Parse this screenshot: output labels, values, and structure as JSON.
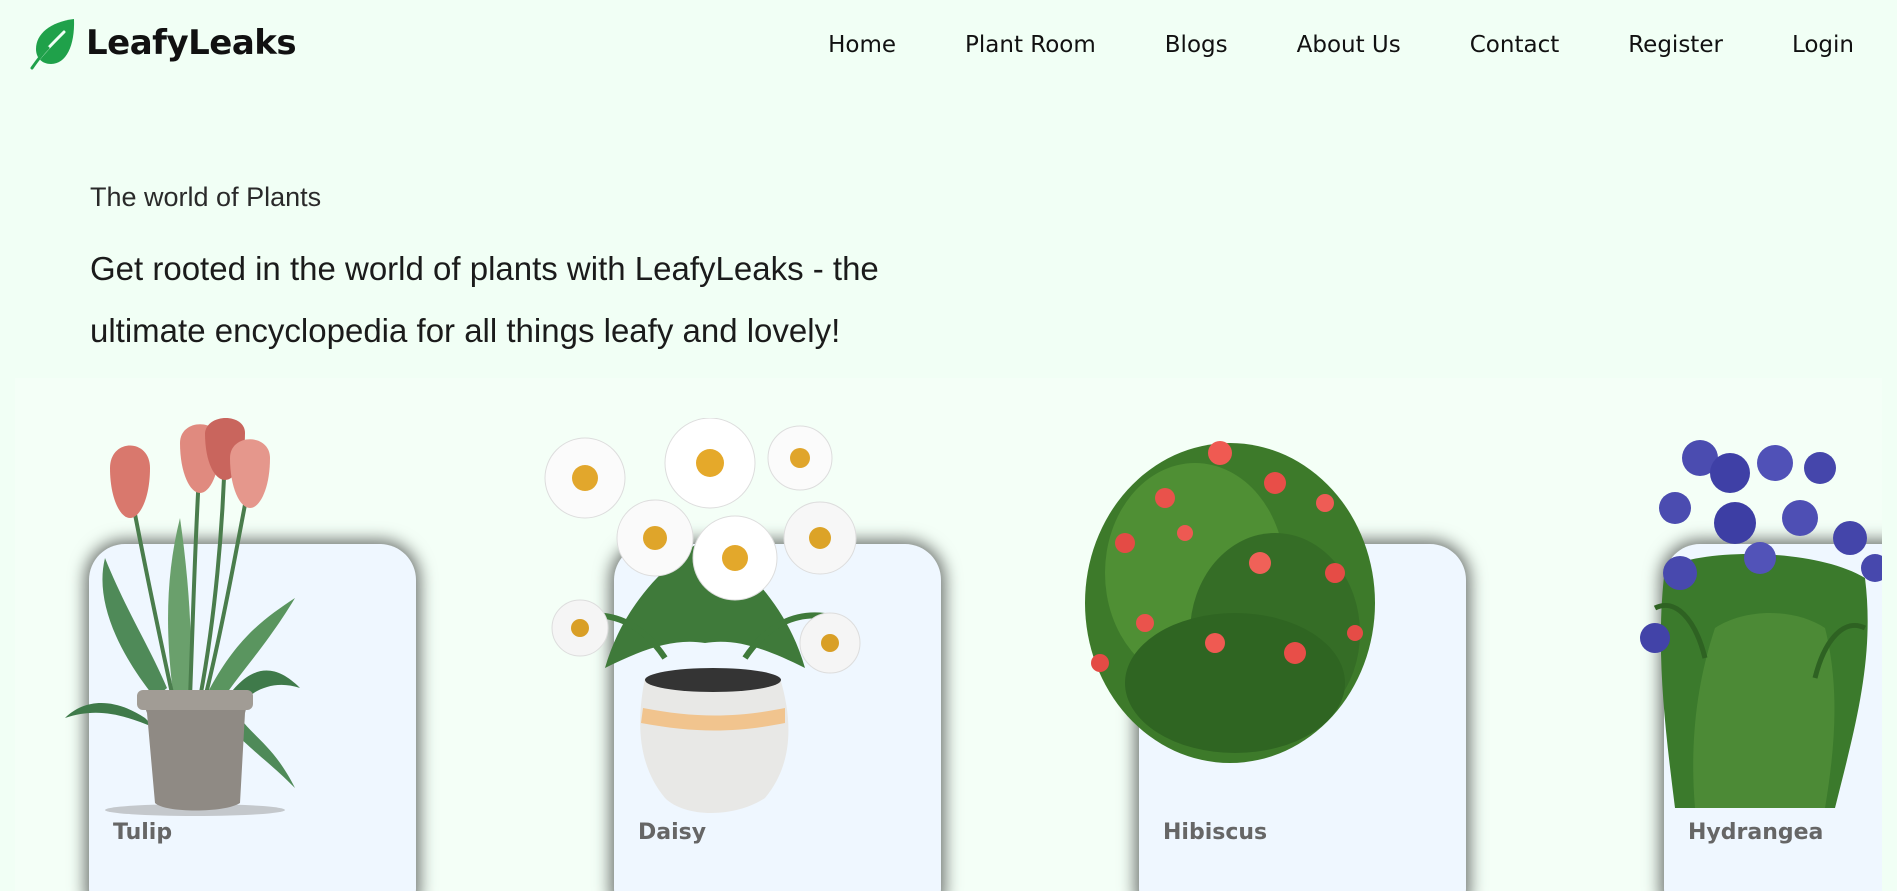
{
  "brand": {
    "name": "LeafyLeaks",
    "logo_icon": "leaf-icon",
    "accent_color": "#1fa14a"
  },
  "nav": {
    "items": [
      {
        "label": "Home"
      },
      {
        "label": "Plant Room"
      },
      {
        "label": "Blogs"
      },
      {
        "label": "About Us"
      },
      {
        "label": "Contact"
      },
      {
        "label": "Register"
      },
      {
        "label": "Login"
      }
    ]
  },
  "hero": {
    "eyebrow": "The world of Plants",
    "title_line1": "Get rooted in the world of plants with LeafyLeaks - the",
    "title_line2": "ultimate encyclopedia for all things leafy and lovely!"
  },
  "plants": [
    {
      "name": "Tulip",
      "icon": "tulip-pot-icon"
    },
    {
      "name": "Daisy",
      "icon": "daisy-pot-icon"
    },
    {
      "name": "Hibiscus",
      "icon": "hibiscus-bush-icon"
    },
    {
      "name": "Hydrangea",
      "icon": "hydrangea-plant-icon"
    }
  ],
  "colors": {
    "page_background": "#f1fff5",
    "card_background": "#eff7ff",
    "card_label": "#666666"
  }
}
